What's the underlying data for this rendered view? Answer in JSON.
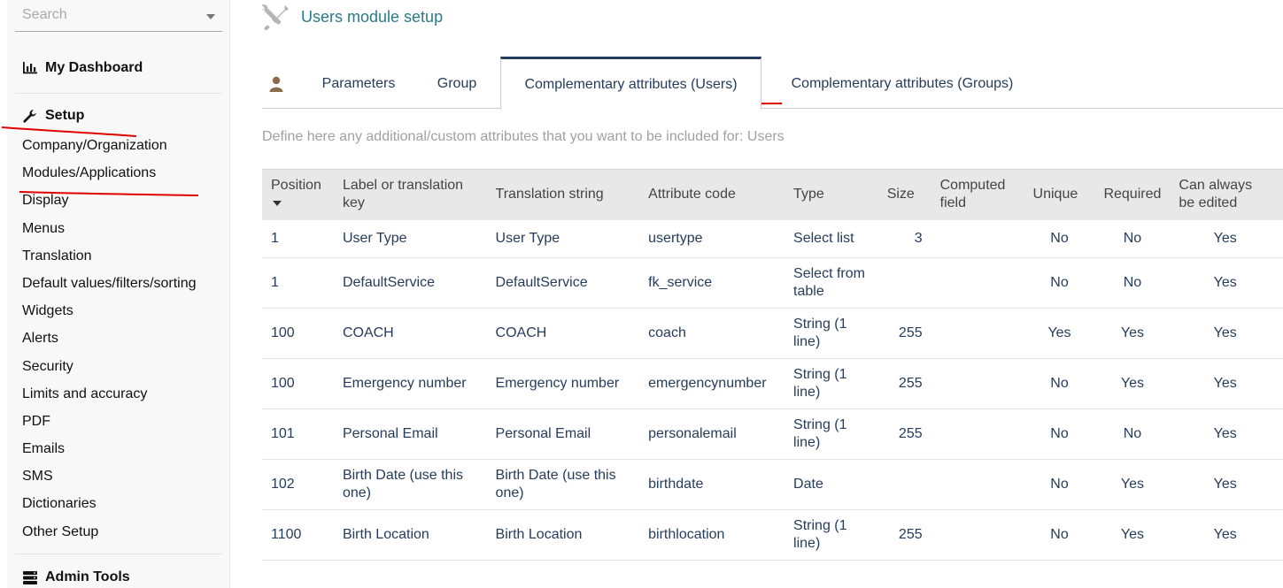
{
  "sidebar": {
    "search_placeholder": "Search",
    "dashboard_label": "My Dashboard",
    "setup_label": "Setup",
    "setup_items": [
      "Company/Organization",
      "Modules/Applications",
      "Display",
      "Menus",
      "Translation",
      "Default values/filters/sorting",
      "Widgets",
      "Alerts",
      "Security",
      "Limits and accuracy",
      "PDF",
      "Emails",
      "SMS",
      "Dictionaries",
      "Other Setup"
    ],
    "admin_tools_label": "Admin Tools"
  },
  "header": {
    "title": "Users module setup",
    "title_color": "#2b7a8a"
  },
  "tabs": [
    {
      "label": "Parameters",
      "active": false
    },
    {
      "label": "Group",
      "active": false
    },
    {
      "label": "Complementary attributes (Users)",
      "active": true
    },
    {
      "label": "Complementary attributes (Groups)",
      "active": false
    }
  ],
  "description": "Define here any additional/custom attributes that you want to be included for: Users",
  "table": {
    "headers": {
      "position": "Position",
      "label": "Label or translation key",
      "translation": "Translation string",
      "code": "Attribute code",
      "type": "Type",
      "size": "Size",
      "computed": "Computed field",
      "unique": "Unique",
      "required": "Required",
      "editable": "Can always be edited"
    },
    "rows": [
      {
        "position": "1",
        "label": "User Type",
        "translation": "User Type",
        "code": "usertype",
        "type": "Select list",
        "size": "3",
        "computed": "",
        "unique": "No",
        "required": "No",
        "editable": "Yes"
      },
      {
        "position": "1",
        "label": "DefaultService",
        "translation": "DefaultService",
        "code": "fk_service",
        "type": "Select from table",
        "size": "",
        "computed": "",
        "unique": "No",
        "required": "No",
        "editable": "Yes"
      },
      {
        "position": "100",
        "label": "COACH",
        "translation": "COACH",
        "code": "coach",
        "type": "String (1 line)",
        "size": "255",
        "computed": "",
        "unique": "Yes",
        "required": "Yes",
        "editable": "Yes"
      },
      {
        "position": "100",
        "label": "Emergency number",
        "translation": "Emergency number",
        "code": "emergencynumber",
        "type": "String (1 line)",
        "size": "255",
        "computed": "",
        "unique": "No",
        "required": "Yes",
        "editable": "Yes"
      },
      {
        "position": "101",
        "label": "Personal Email",
        "translation": "Personal Email",
        "code": "personalemail",
        "type": "String (1 line)",
        "size": "255",
        "computed": "",
        "unique": "No",
        "required": "No",
        "editable": "Yes"
      },
      {
        "position": "102",
        "label": "Birth Date (use this one)",
        "translation": "Birth Date (use this one)",
        "code": "birthdate",
        "type": "Date",
        "size": "",
        "computed": "",
        "unique": "No",
        "required": "Yes",
        "editable": "Yes"
      },
      {
        "position": "1100",
        "label": "Birth Location",
        "translation": "Birth Location",
        "code": "birthlocation",
        "type": "String (1 line)",
        "size": "255",
        "computed": "",
        "unique": "No",
        "required": "Yes",
        "editable": "Yes"
      }
    ]
  },
  "annotation_color": "#e00000"
}
